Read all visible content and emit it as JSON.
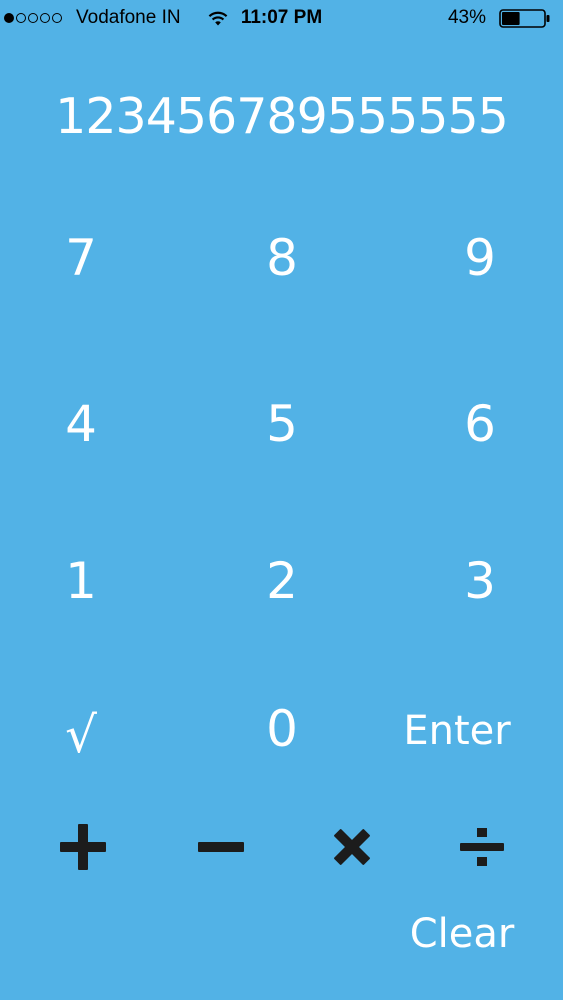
{
  "status_bar": {
    "signal_dots_filled": 1,
    "signal_dots_total": 5,
    "carrier": "Vodafone IN",
    "time": "11:07 PM",
    "battery_percent_label": "43%",
    "battery_level": 0.43
  },
  "display": {
    "value": "123456789555555"
  },
  "keypad": {
    "row1": [
      "7",
      "8",
      "9"
    ],
    "row2": [
      "4",
      "5",
      "6"
    ],
    "row3": [
      "1",
      "2",
      "3"
    ],
    "sqrt": "√",
    "zero": "0",
    "enter": "Enter",
    "clear": "Clear"
  },
  "operators": [
    {
      "name": "plus-icon"
    },
    {
      "name": "minus-icon"
    },
    {
      "name": "multiply-icon"
    },
    {
      "name": "divide-icon"
    }
  ],
  "colors": {
    "background": "#52b2e6",
    "text": "#ffffff",
    "operator_icons": "#1c1c1c"
  }
}
